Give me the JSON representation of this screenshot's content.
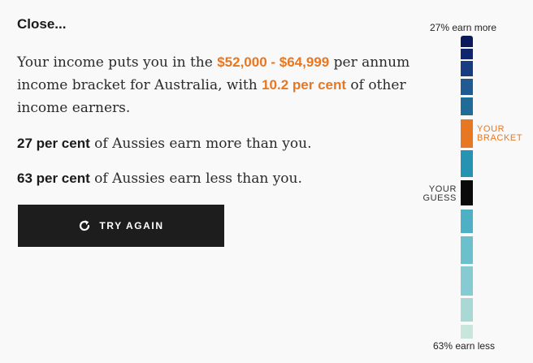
{
  "heading": "Close...",
  "result": {
    "p1_prefix": "Your income puts you in the ",
    "bracket": "$52,000 - $64,999",
    "p1_middle": " per annum income bracket for Australia, with ",
    "share": "10.2 per cent",
    "p1_suffix": " of other income earners.",
    "more_pct": "27 per cent",
    "more_text": " of Aussies earn more than you.",
    "less_pct": "63 per cent",
    "less_text": " of Aussies earn less than you."
  },
  "button": {
    "label": "TRY AGAIN",
    "icon": "refresh-icon"
  },
  "bar": {
    "top_label": "27% earn more",
    "bottom_label": "63% earn less",
    "your_bracket_line1": "YOUR",
    "your_bracket_line2": "BRACKET",
    "your_guess_line1": "YOUR",
    "your_guess_line2": "GUESS",
    "segments": [
      {
        "color": "#0d1a5a"
      },
      {
        "color": "#11256e"
      },
      {
        "color": "#173c82"
      },
      {
        "color": "#1f5a93"
      },
      {
        "color": "#1f6c98"
      },
      {
        "color": "#e87722",
        "role": "your-bracket"
      },
      {
        "color": "#2693b2"
      },
      {
        "color": "#0a0a0a",
        "role": "your-guess"
      },
      {
        "color": "#4db0c4"
      },
      {
        "color": "#6bc0cc"
      },
      {
        "color": "#86cbd2"
      },
      {
        "color": "#a8d9d4"
      },
      {
        "color": "#c8e6dc"
      }
    ]
  }
}
